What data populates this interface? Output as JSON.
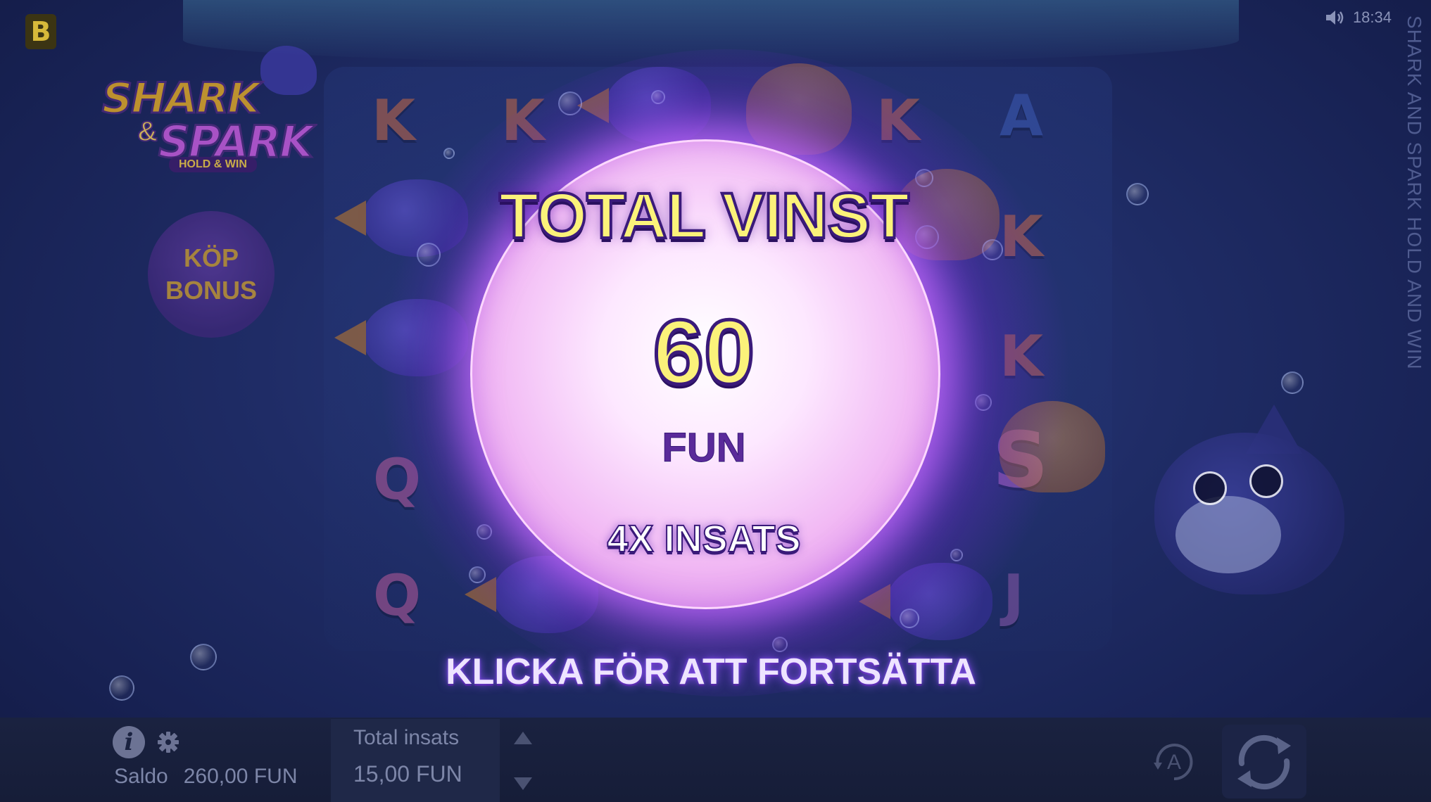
{
  "brand": {
    "letter": "B"
  },
  "logo": {
    "line1": "SHARK",
    "ampersand": "&",
    "line2": "SPARK",
    "tagline": "HOLD & WIN"
  },
  "buy_bonus": {
    "line1": "KÖP",
    "line2": "BONUS"
  },
  "status": {
    "time": "18:34"
  },
  "side_title": "SHARK AND SPARK HOLD AND WIN",
  "reel_symbols": [
    "K",
    "K",
    "K",
    "A",
    "K",
    "K",
    "Q",
    "Q",
    "S",
    "J"
  ],
  "win_popup": {
    "title": "TOTAL VINST",
    "amount": "60",
    "currency": "FUN",
    "multiplier": "4X INSATS",
    "continue_prompt": "KLICKA FÖR ATT FORTSÄTTA"
  },
  "bottom_bar": {
    "balance_label": "Saldo",
    "balance_value": "260,00 FUN",
    "bet_label": "Total insats",
    "bet_value": "15,00 FUN",
    "autoplay_label": "A"
  },
  "colors": {
    "background": "#1f2c66",
    "glow": "#a046ff",
    "title_fill": "#fbf27a",
    "title_stroke": "#3a1a7a"
  }
}
